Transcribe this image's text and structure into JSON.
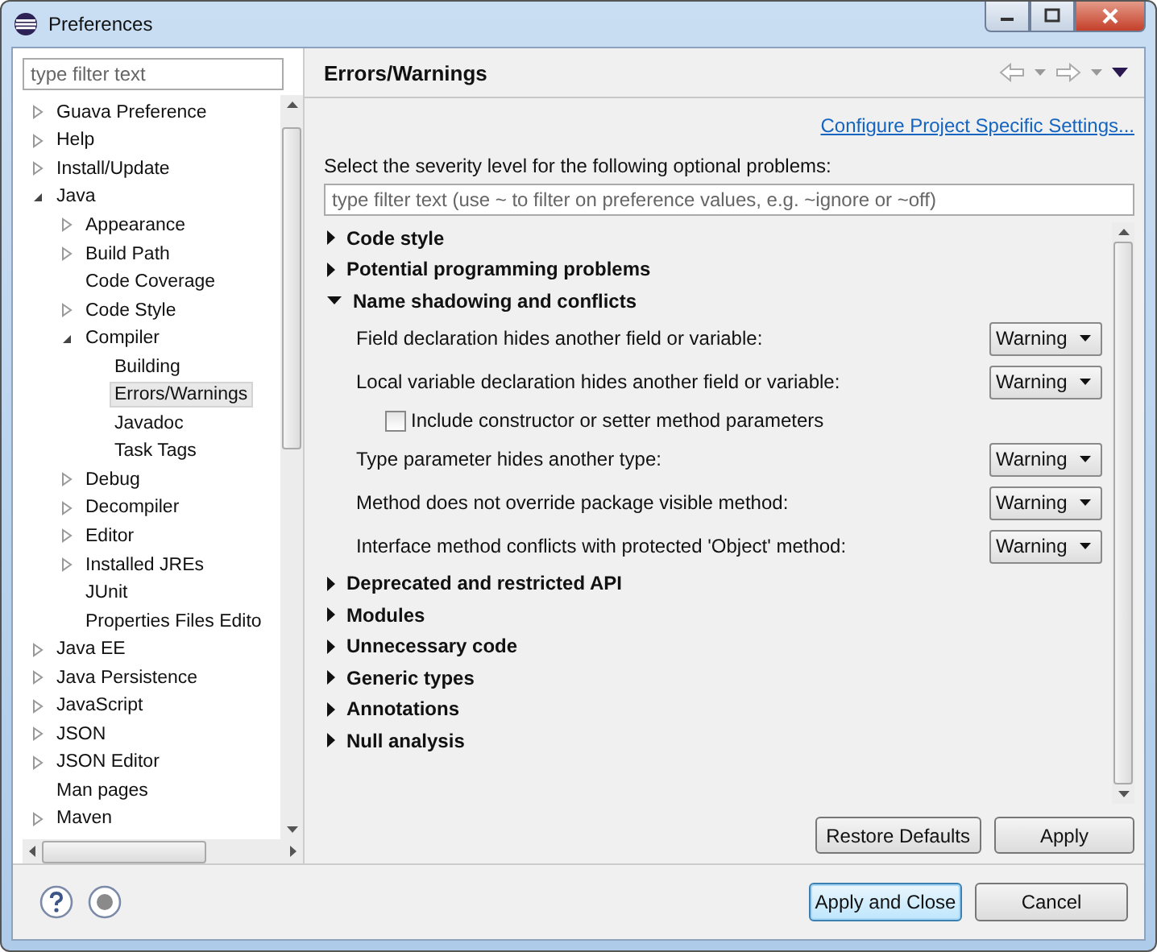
{
  "window": {
    "title": "Preferences"
  },
  "sidebar": {
    "filter": {
      "placeholder": "type filter text"
    },
    "tree": [
      {
        "label": "Guava Preference",
        "expanded": false,
        "selected": false
      },
      {
        "label": "Help",
        "expanded": false,
        "selected": false
      },
      {
        "label": "Install/Update",
        "expanded": false,
        "selected": false
      },
      {
        "label": "Java",
        "expanded": true,
        "selected": false,
        "children": [
          {
            "label": "Appearance",
            "expanded": false,
            "selected": false
          },
          {
            "label": "Build Path",
            "expanded": false,
            "selected": false
          },
          {
            "label": "Code Coverage",
            "selected": false
          },
          {
            "label": "Code Style",
            "expanded": false,
            "selected": false
          },
          {
            "label": "Compiler",
            "expanded": true,
            "selected": false,
            "children": [
              {
                "label": "Building",
                "selected": false
              },
              {
                "label": "Errors/Warnings",
                "selected": true
              },
              {
                "label": "Javadoc",
                "selected": false
              },
              {
                "label": "Task Tags",
                "selected": false
              }
            ]
          },
          {
            "label": "Debug",
            "expanded": false,
            "selected": false
          },
          {
            "label": "Decompiler",
            "expanded": false,
            "selected": false
          },
          {
            "label": "Editor",
            "expanded": false,
            "selected": false
          },
          {
            "label": "Installed JREs",
            "expanded": false,
            "selected": false
          },
          {
            "label": "JUnit",
            "selected": false
          },
          {
            "label": "Properties Files Edito",
            "selected": false
          }
        ]
      },
      {
        "label": "Java EE",
        "expanded": false,
        "selected": false
      },
      {
        "label": "Java Persistence",
        "expanded": false,
        "selected": false
      },
      {
        "label": "JavaScript",
        "expanded": false,
        "selected": false
      },
      {
        "label": "JSON",
        "expanded": false,
        "selected": false
      },
      {
        "label": "JSON Editor",
        "expanded": false,
        "selected": false
      },
      {
        "label": "Man pages",
        "selected": false
      },
      {
        "label": "Maven",
        "expanded": false,
        "selected": false
      }
    ]
  },
  "page": {
    "title": "Errors/Warnings",
    "link": "Configure Project Specific Settings...",
    "intro": "Select the severity level for the following optional problems:",
    "filter": {
      "placeholder": "type filter text (use ~ to filter on preference values, e.g. ~ignore or ~off)"
    },
    "sections": [
      {
        "label": "Code style",
        "expanded": false
      },
      {
        "label": "Potential programming problems",
        "expanded": false
      },
      {
        "label": "Name shadowing and conflicts",
        "expanded": true,
        "options": [
          {
            "kind": "combo",
            "label": "Field declaration hides another field or variable:",
            "value": "Warning"
          },
          {
            "kind": "combo",
            "label": "Local variable declaration hides another field or variable:",
            "value": "Warning"
          },
          {
            "kind": "checkbox",
            "label": "Include constructor or setter method parameters",
            "checked": false
          },
          {
            "kind": "combo",
            "label": "Type parameter hides another type:",
            "value": "Warning"
          },
          {
            "kind": "combo",
            "label": "Method does not override package visible method:",
            "value": "Warning"
          },
          {
            "kind": "combo",
            "label": "Interface method conflicts with protected 'Object' method:",
            "value": "Warning"
          }
        ]
      },
      {
        "label": "Deprecated and restricted API",
        "expanded": false
      },
      {
        "label": "Modules",
        "expanded": false
      },
      {
        "label": "Unnecessary code",
        "expanded": false
      },
      {
        "label": "Generic types",
        "expanded": false
      },
      {
        "label": "Annotations",
        "expanded": false
      },
      {
        "label": "Null analysis",
        "expanded": false
      }
    ],
    "buttons": [
      "Restore Defaults",
      "Apply"
    ]
  },
  "footer": {
    "buttons": [
      {
        "label": "Apply and Close",
        "default": true
      },
      {
        "label": "Cancel",
        "default": false
      }
    ]
  }
}
